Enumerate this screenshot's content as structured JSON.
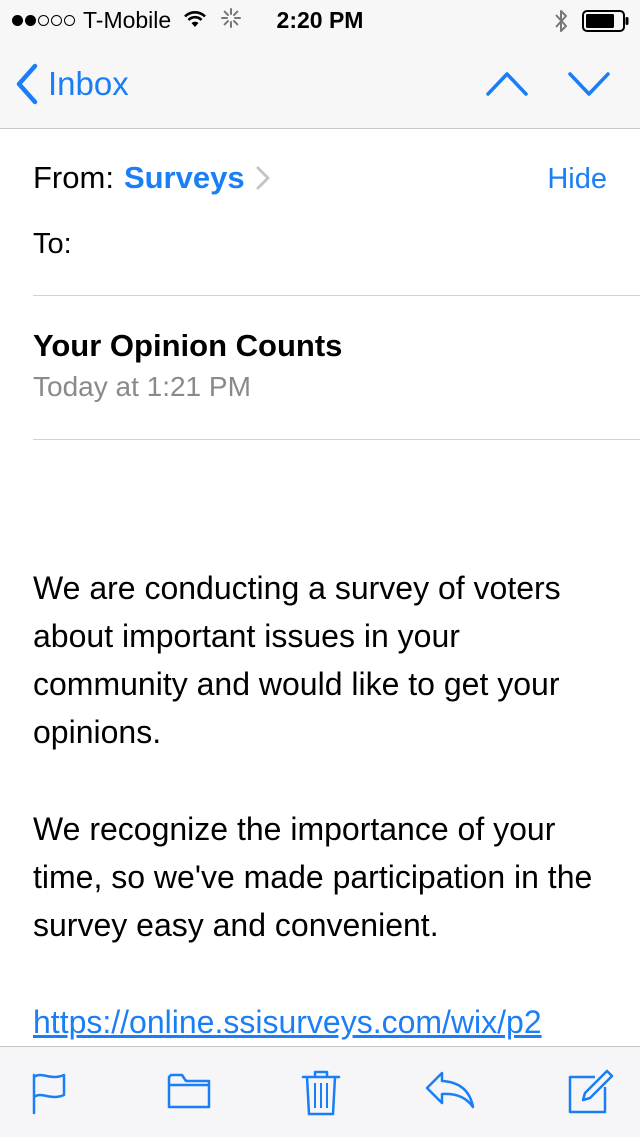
{
  "status_bar": {
    "carrier": "T-Mobile",
    "time": "2:20 PM"
  },
  "nav": {
    "back_label": "Inbox"
  },
  "header": {
    "from_label": "From:",
    "sender": "Surveys",
    "hide_label": "Hide",
    "to_label": "To:",
    "subject": "Your Opinion Counts",
    "date": "Today at 1:21 PM"
  },
  "body": {
    "paragraph_1": "We are conducting a survey of voters about important issues in your community and would like to get your opinions.",
    "paragraph_2": "We recognize the importance of your time, so we've made participation in the survey easy and convenient.",
    "link": "https://online.ssisurveys.com/wix/p2"
  },
  "toolbar": {
    "icons": [
      "flag-icon",
      "folder-icon",
      "trash-icon",
      "reply-icon",
      "compose-icon"
    ]
  },
  "colors": {
    "accent": "#1a7ef7",
    "secondary_text": "#8a8a8e",
    "bar_background": "#f7f7f8"
  }
}
